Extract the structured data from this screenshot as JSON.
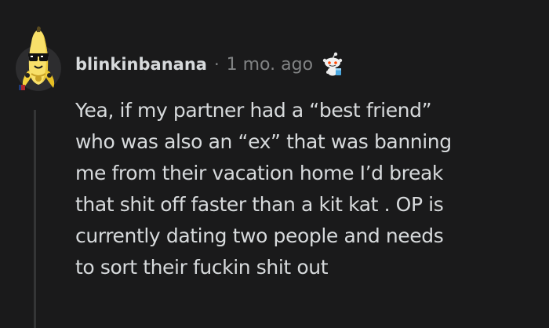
{
  "comment": {
    "author": "blinkinbanana",
    "separator": "·",
    "timestamp": "1 mo. ago",
    "avatar_icon": "banana-snoo-avatar-icon",
    "award_icon": "snoo-award-icon",
    "body_lines": [
      "Yea, if my partner had a “best friend”",
      "who was also an “ex” that was banning",
      "me from their vacation home I’d break",
      "that shit off faster than a kit kat . OP is",
      "currently dating two people and needs",
      "to sort their fuckin shit out"
    ]
  },
  "colors": {
    "background": "#1a1a1b",
    "text": "#d7dadc",
    "meta_text": "#818384",
    "thread_line": "#343536"
  }
}
